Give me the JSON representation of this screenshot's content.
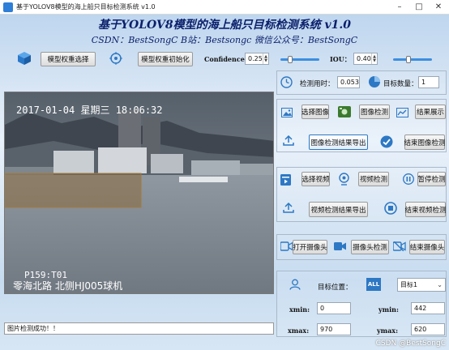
{
  "window": {
    "title": "基于YOLOV8模型的海上船只目标检测系统 v1.0",
    "minimize": "–",
    "maximize": "□",
    "close": "✕"
  },
  "header": {
    "title": "基于YOLOV8模型的海上船只目标检测系统 v1.0",
    "subtitle": "CSDN：BestSongC   B站：Bestsongc   微信公众号：BestSongC"
  },
  "toolbar": {
    "model_select_label": "模型权重选择",
    "model_init_label": "模型权重初始化",
    "confidence_label": "Confidence:",
    "confidence_value": "0.25",
    "confidence_level": 0.25,
    "iou_label": "IOU：",
    "iou_value": "0.40",
    "iou_level": 0.4
  },
  "video": {
    "timestamp": "2017-01-04  星期三  18:06:32",
    "cam_id": "P159:T01",
    "location": "零海北路 北侧HJ005球机"
  },
  "status_bar": {
    "message": "图片检测成功！！"
  },
  "stats": {
    "time_label": "检测用时：",
    "time_value": "0.053",
    "count_label": "目标数量：",
    "count_value": "1"
  },
  "image_section": {
    "select_label": "选择图像",
    "detect_label": "图像检测",
    "show_label": "结果展示",
    "export_label": "图像检测结果导出",
    "end_label": "结束图像检测"
  },
  "video_section": {
    "select_label": "选择视频",
    "detect_label": "视频检测",
    "pause_label": "暂停检测",
    "export_label": "视频检测结果导出",
    "end_label": "结束视频检测"
  },
  "camera_section": {
    "open_label": "打开摄像头",
    "detect_label": "摄像头检测",
    "end_label": "结束摄像头"
  },
  "target": {
    "position_label": "目标位置：",
    "all_badge": "ALL",
    "select_value": "目标1",
    "xmin_label": "xmin:",
    "xmin_value": "0",
    "ymin_label": "ymin:",
    "ymin_value": "442",
    "xmax_label": "xmax:",
    "xmax_value": "970",
    "ymax_label": "ymax:",
    "ymax_value": "620"
  },
  "watermark": "CSDN @BestSongC",
  "colors": {
    "title_text": "#0b1f6b",
    "accent": "#2d78c4",
    "panel_border": "#a9b9cb"
  }
}
